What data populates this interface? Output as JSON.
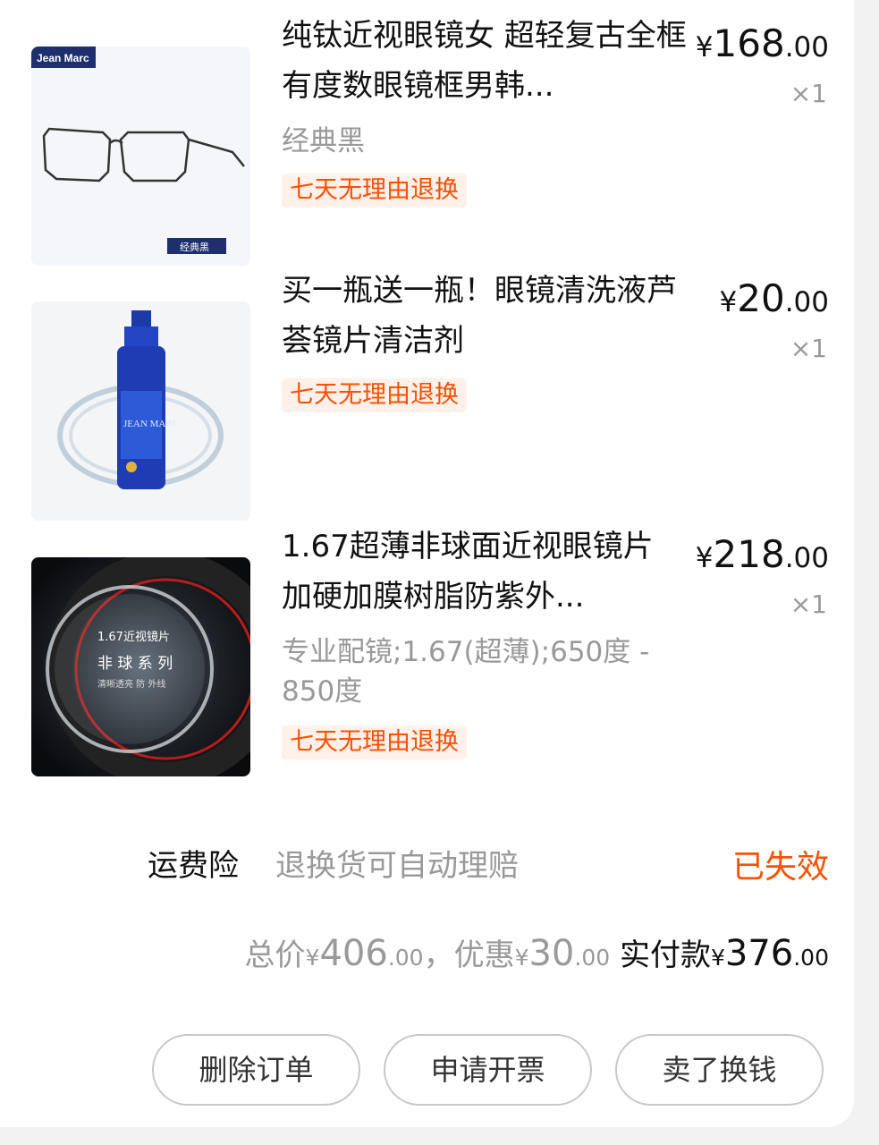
{
  "items": [
    {
      "title": "纯钛近视眼镜女 超轻复古全框有度数眼镜框男韩...",
      "variant": "经典黑",
      "tag": "七天无理由退换",
      "price": {
        "yen": "¥",
        "int": "168",
        "dec": ".00"
      },
      "qty": "×1",
      "image": {
        "brand": "Jean Marc",
        "badge": "经典黑"
      }
    },
    {
      "title": "买一瓶送一瓶！眼镜清洗液芦荟镜片清洁剂",
      "variant": "",
      "tag": "七天无理由退换",
      "price": {
        "yen": "¥",
        "int": "20",
        "dec": ".00"
      },
      "qty": "×1",
      "image": {
        "brand": "JEAN MARC"
      }
    },
    {
      "title": "1.67超薄非球面近视眼镜片 加硬加膜树脂防紫外...",
      "variant": "专业配镜;1.67(超薄);650度 - 850度",
      "tag": "七天无理由退换",
      "price": {
        "yen": "¥",
        "int": "218",
        "dec": ".00"
      },
      "qty": "×1",
      "image": {
        "line1": "1.67近视镜片",
        "line2": "非 球 系 列",
        "line3": "清晰透亮 防 外线"
      }
    }
  ],
  "shipping": {
    "label": "运费险",
    "desc": "退换货可自动理赔",
    "status": "已失效"
  },
  "totals": {
    "total_label": "总价",
    "total_yen": "¥",
    "total_int": "406",
    "total_dec": ".00",
    "sep": "，",
    "discount_label": "优惠",
    "discount_yen": "¥",
    "discount_int": "30",
    "discount_dec": ".00",
    "paid_label": "实付款",
    "paid_yen": "¥",
    "paid_int": "376",
    "paid_dec": ".00"
  },
  "buttons": {
    "delete": "删除订单",
    "invoice": "申请开票",
    "resell": "卖了换钱"
  },
  "colors": {
    "accent": "#ff4f00",
    "tag_bg": "#fff0ea",
    "muted": "#999999"
  }
}
